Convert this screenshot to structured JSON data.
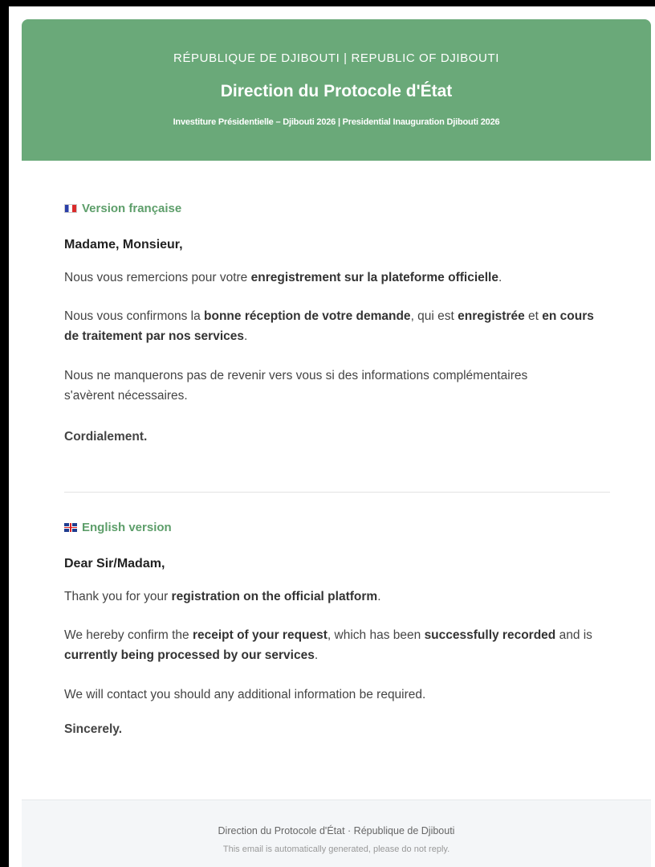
{
  "header": {
    "country": "RÉPUBLIQUE DE DJIBOUTI | REPUBLIC OF DJIBOUTI",
    "title": "Direction du Protocole d'État",
    "subtitle": "Investiture Présidentielle – Djibouti 2026 | Presidential Inauguration Djibouti 2026",
    "bg_color": "#6aa979"
  },
  "french": {
    "section_label": "Version française",
    "flag_icon": "flag-france-icon",
    "greeting": "Madame, Monsieur,",
    "p1": {
      "a": "Nous vous remercions pour votre ",
      "b": "enregistrement sur la plateforme officielle",
      "c": "."
    },
    "p2": {
      "a": "Nous vous confirmons la ",
      "b": "bonne réception de votre demande",
      "c": ", qui est ",
      "d": "enregistrée",
      "e": " et ",
      "f": "en cours de traitement par nos services",
      "g": "."
    },
    "p3": "Nous ne manquerons pas de revenir vers vous si des informations complémentaires s'avèrent nécessaires.",
    "closing": "Cordialement."
  },
  "english": {
    "section_label": "English version",
    "flag_icon": "flag-uk-icon",
    "greeting": "Dear Sir/Madam,",
    "p1": {
      "a": "Thank you for your ",
      "b": "registration on the official platform",
      "c": "."
    },
    "p2": {
      "a": "We hereby confirm the ",
      "b": "receipt of your request",
      "c": ", which has been ",
      "d": "successfully recorded",
      "e": " and is ",
      "f": "currently being processed by our services",
      "g": "."
    },
    "p3": "We will contact you should any additional information be required.",
    "closing": "Sincerely."
  },
  "footer": {
    "line1": "Direction du Protocole d'État  ·  République de Djibouti",
    "line2": "This email is automatically generated, please do not reply."
  },
  "colors": {
    "accent_green": "#5d9e6a",
    "footer_bg": "#f4f6f8"
  }
}
